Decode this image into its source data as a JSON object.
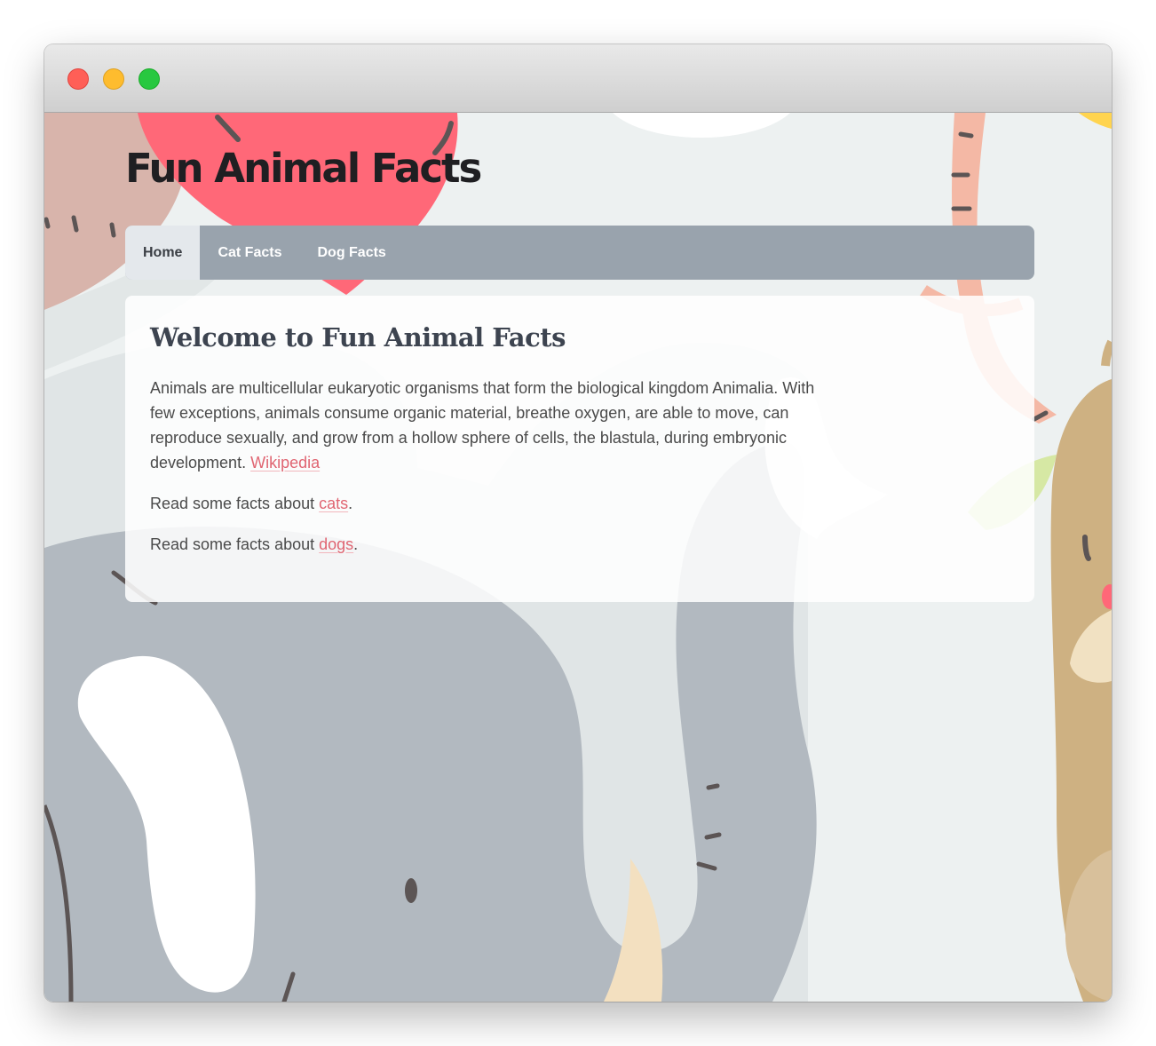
{
  "site": {
    "title": "Fun Animal Facts"
  },
  "nav": {
    "items": [
      {
        "label": "Home"
      },
      {
        "label": "Cat Facts"
      },
      {
        "label": "Dog Facts"
      }
    ]
  },
  "main": {
    "heading": "Welcome to Fun Animal Facts",
    "intro_text": "Animals are multicellular eukaryotic organisms that form the biological kingdom Animalia. With few exceptions, animals consume organic material, breathe oxygen, are able to move, can reproduce sexually, and grow from a hollow sphere of cells, the blastula, during embryonic development.",
    "wikipedia_link": "Wikipedia",
    "cats_prefix": "Read some facts about",
    "cats_link": "cats",
    "dogs_prefix": "Read some facts about",
    "dogs_link": "dogs",
    "period": "."
  },
  "colors": {
    "nav_bg": "#99a3ad",
    "nav_active_bg": "#e4e8ec",
    "link": "#e06572",
    "elephant": "#b2b9c0",
    "heart": "#ff6b78",
    "giraffe": "#ceb182"
  }
}
